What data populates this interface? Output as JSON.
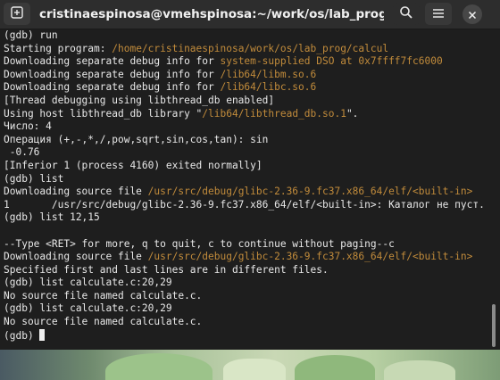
{
  "window": {
    "title": "cristinaespinosa@vmehspinosa:~/work/os/lab_prog — gdb ./calcul"
  },
  "icons": {
    "new_tab": "plus-square-icon",
    "search": "search-icon",
    "menu": "hamburger-menu-icon",
    "close": "close-icon"
  },
  "colors": {
    "terminal_bg": "#1e1e1e",
    "terminal_fg": "#e8e8e8",
    "path_highlight": "#c18b3b",
    "headerbar_bg": "#2d2d2d"
  },
  "terminal": {
    "lines": [
      [
        {
          "t": "(gdb) run"
        }
      ],
      [
        {
          "t": "Starting program: "
        },
        {
          "t": "/home/cristinaespinosa/work/os/lab_prog/calcul",
          "h": true
        }
      ],
      [
        {
          "t": "Downloading separate debug info for "
        },
        {
          "t": "system-supplied DSO at 0x7ffff7fc6000",
          "h": true
        }
      ],
      [
        {
          "t": "Downloading separate debug info for "
        },
        {
          "t": "/lib64/libm.so.6",
          "h": true
        }
      ],
      [
        {
          "t": "Downloading separate debug info for "
        },
        {
          "t": "/lib64/libc.so.6",
          "h": true
        }
      ],
      [
        {
          "t": "[Thread debugging using libthread_db enabled]"
        }
      ],
      [
        {
          "t": "Using host libthread_db library \""
        },
        {
          "t": "/lib64/libthread_db.so.1",
          "h": true
        },
        {
          "t": "\"."
        }
      ],
      [
        {
          "t": "Число: 4"
        }
      ],
      [
        {
          "t": "Операция (+,-,*,/,pow,sqrt,sin,cos,tan): sin"
        }
      ],
      [
        {
          "t": " -0.76"
        }
      ],
      [
        {
          "t": "[Inferior 1 (process 4160) exited normally]"
        }
      ],
      [
        {
          "t": "(gdb) list"
        }
      ],
      [
        {
          "t": "Downloading source file "
        },
        {
          "t": "/usr/src/debug/glibc-2.36-9.fc37.x86_64/elf/<built-in>",
          "h": true
        }
      ],
      [
        {
          "t": "1       /usr/src/debug/glibc-2.36-9.fc37.x86_64/elf/<built-in>: Каталог не пуст."
        }
      ],
      [
        {
          "t": "(gdb) list 12,15"
        }
      ],
      [
        {
          "t": ""
        }
      ],
      [
        {
          "t": "--Type <RET> for more, q to quit, c to continue without paging--c"
        }
      ],
      [
        {
          "t": "Downloading source file "
        },
        {
          "t": "/usr/src/debug/glibc-2.36-9.fc37.x86_64/elf/<built-in>",
          "h": true
        }
      ],
      [
        {
          "t": "Specified first and last lines are in different files."
        }
      ],
      [
        {
          "t": "(gdb) list calculate.c:20,29"
        }
      ],
      [
        {
          "t": "No source file named calculate.c."
        }
      ],
      [
        {
          "t": "(gdb) list calculate.c:20,29"
        }
      ],
      [
        {
          "t": "No source file named calculate.c."
        }
      ],
      [
        {
          "t": "(gdb) "
        }
      ]
    ]
  }
}
